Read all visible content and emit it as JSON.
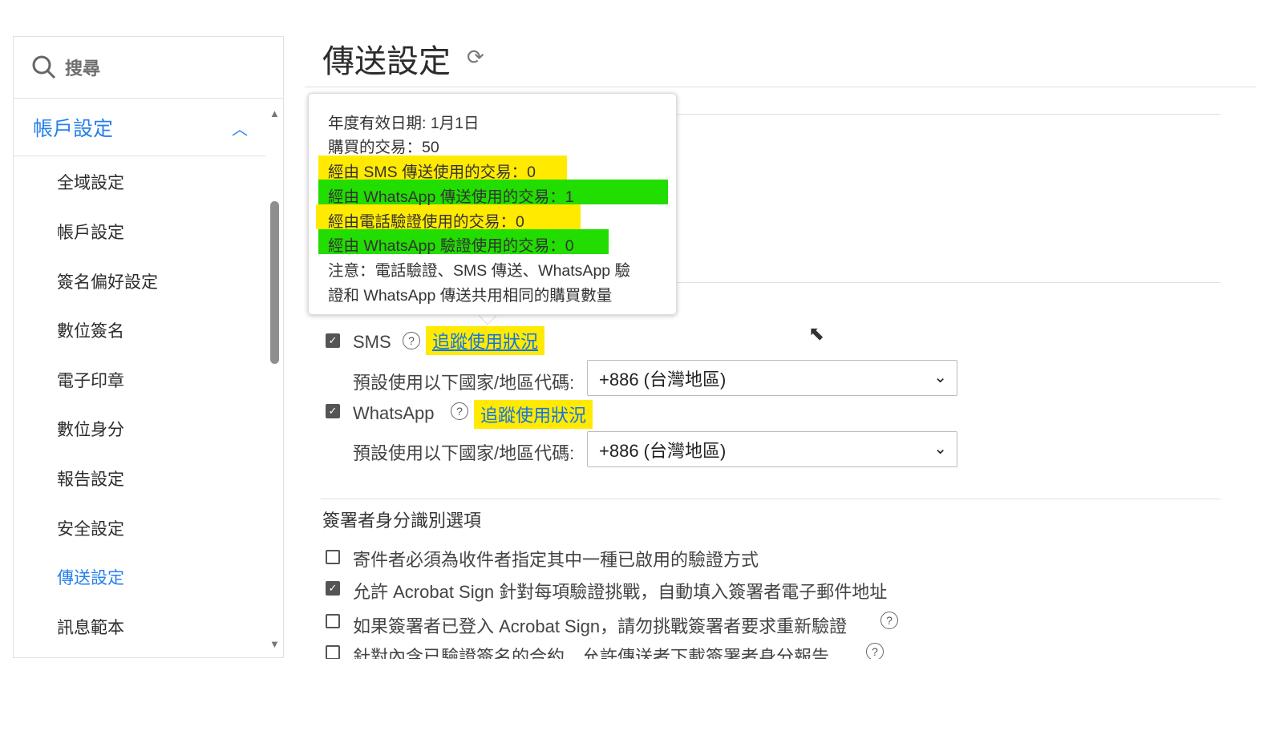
{
  "sidebar": {
    "search_placeholder": "搜尋",
    "group_label": "帳戶設定",
    "items": [
      {
        "label": "全域設定"
      },
      {
        "label": "帳戶設定"
      },
      {
        "label": "簽名偏好設定"
      },
      {
        "label": "數位簽名"
      },
      {
        "label": "電子印章"
      },
      {
        "label": "數位身分"
      },
      {
        "label": "報告設定"
      },
      {
        "label": "安全設定"
      },
      {
        "label": "傳送設定",
        "active": true
      },
      {
        "label": "訊息範本"
      }
    ]
  },
  "main": {
    "title": "傳送設定",
    "tooltip": {
      "lines": [
        "年度有效日期: 1月1日",
        "購買的交易：50",
        "經由 SMS 傳送使用的交易：0",
        "經由 WhatsApp 傳送使用的交易：1",
        "經由電話驗證使用的交易：0",
        "經由 WhatsApp 驗證使用的交易：0",
        "注意：電話驗證、SMS 傳送、WhatsApp 驗",
        "證和 WhatsApp 傳送共用相同的購買數量"
      ]
    },
    "sms": {
      "label": "SMS",
      "checked": true,
      "track_link": "追蹤使用狀況",
      "country_label": "預設使用以下國家/地區代碼:",
      "country_value": "+886 (台灣地區)"
    },
    "whatsapp": {
      "label": "WhatsApp",
      "checked": true,
      "track_link": "追蹤使用狀況",
      "country_label": "預設使用以下國家/地區代碼:",
      "country_value": "+886 (台灣地區)"
    },
    "identity": {
      "heading": "簽署者身分識別選項",
      "options": [
        {
          "label": "寄件者必須為收件者指定其中一種已啟用的驗證方式",
          "checked": false
        },
        {
          "label": "允許 Acrobat Sign 針對每項驗證挑戰，自動填入簽署者電子郵件地址",
          "checked": true
        },
        {
          "label": "如果簽署者已登入 Acrobat Sign，請勿挑戰簽署者要求重新驗證",
          "checked": false
        },
        {
          "label": "針對內含已驗證簽名的合約，允許傳送者下載簽署者身分報告",
          "checked": false
        }
      ]
    }
  },
  "colors": {
    "accent": "#2680eb",
    "highlight_yellow": "#ffea00",
    "highlight_green": "#22dd00"
  }
}
